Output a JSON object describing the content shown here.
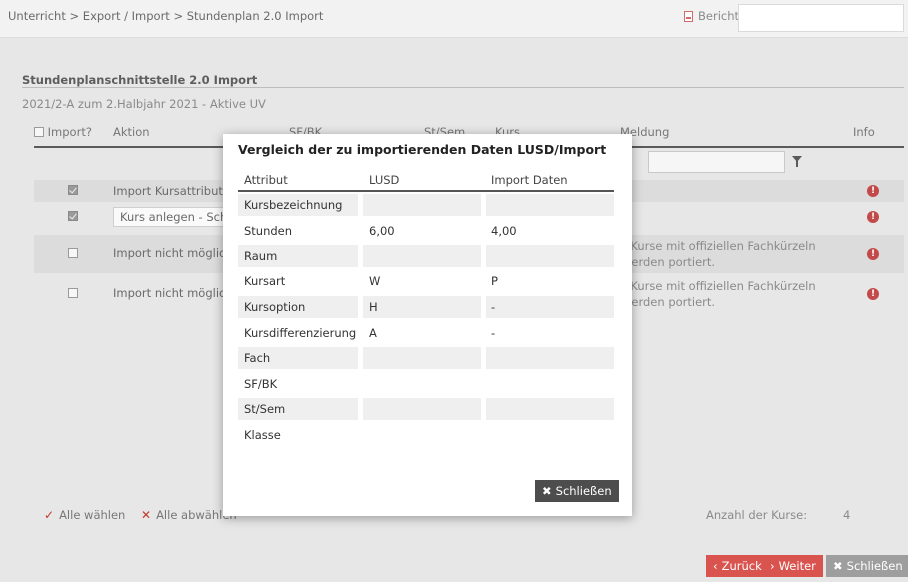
{
  "topbar": {
    "breadcrumb": "Unterricht > Export / Import > Stundenplan 2.0 Import",
    "report_label": "Bericht"
  },
  "section": {
    "title": "Stundenplanschnittstelle 2.0 Import",
    "subtitle": "2021/2-A zum 2.Halbjahr 2021 - Aktive UV"
  },
  "table": {
    "columns": [
      "Import?",
      "Aktion",
      "SF/BK",
      "St/Sem",
      "Kurs",
      "Meldung",
      "Info"
    ],
    "rows": [
      {
        "checked": true,
        "action": "Import Kursattribute",
        "message": ""
      },
      {
        "checked": true,
        "action": "Kurs anlegen - Schüle",
        "message": ""
      },
      {
        "checked": false,
        "action": "Import nicht möglich",
        "message": "r Kurse mit offiziellen Fachkürzeln werden portiert."
      },
      {
        "checked": false,
        "action": "Import nicht möglich",
        "message": "r Kurse mit offiziellen Fachkürzeln werden portiert."
      }
    ]
  },
  "footer": {
    "select_all": "Alle wählen",
    "deselect_all": "Alle abwählen",
    "count_label": "Anzahl der Kurse:",
    "count_value": "4"
  },
  "buttons": {
    "back": "Zurück",
    "next": "Weiter",
    "close": "Schließen"
  },
  "modal": {
    "title": "Vergleich der zu importierenden Daten LUSD/Import",
    "headers": [
      "Attribut",
      "LUSD",
      "Import Daten"
    ],
    "rows": [
      {
        "attr": "Kursbezeichnung",
        "lusd": "",
        "import": ""
      },
      {
        "attr": "Stunden",
        "lusd": "6,00",
        "import": "4,00"
      },
      {
        "attr": "Raum",
        "lusd": "",
        "import": ""
      },
      {
        "attr": "Kursart",
        "lusd": "W",
        "import": "P"
      },
      {
        "attr": "Kursoption",
        "lusd": "H",
        "import": "-"
      },
      {
        "attr": "Kursdifferenzierung",
        "lusd": "A",
        "import": "-"
      },
      {
        "attr": "Fach",
        "lusd": "",
        "import": ""
      },
      {
        "attr": "SF/BK",
        "lusd": "",
        "import": ""
      },
      {
        "attr": "St/Sem",
        "lusd": "",
        "import": ""
      },
      {
        "attr": "Klasse",
        "lusd": "",
        "import": ""
      }
    ],
    "close_label": "Schließen"
  },
  "colors": {
    "accent_red": "#d9534f",
    "info_red": "#c34a4a",
    "grey_button": "#9e9e9e",
    "dark_button": "#4d4d4d"
  }
}
